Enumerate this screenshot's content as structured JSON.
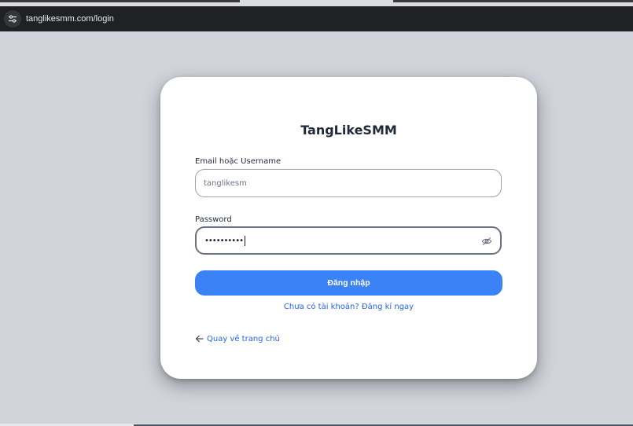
{
  "browser": {
    "url": "tanglikesmm.com/login"
  },
  "login": {
    "title": "TangLikeSMM",
    "username_label": "Email hoặc Username",
    "username_value": "tanglikesm",
    "password_label": "Password",
    "password_value": "••••••••••",
    "submit_label": "Đăng nhập",
    "register_prompt": "Chưa có tài khoản? Đăng kí ngay",
    "back_home": "Quay về trang chủ"
  },
  "icons": {
    "site_info": "tune-icon",
    "password_toggle": "eye-off-icon",
    "back": "arrow-left-icon"
  },
  "colors": {
    "accent": "#3b82f6",
    "link": "#2563eb",
    "page_bg": "#d1d5db"
  }
}
